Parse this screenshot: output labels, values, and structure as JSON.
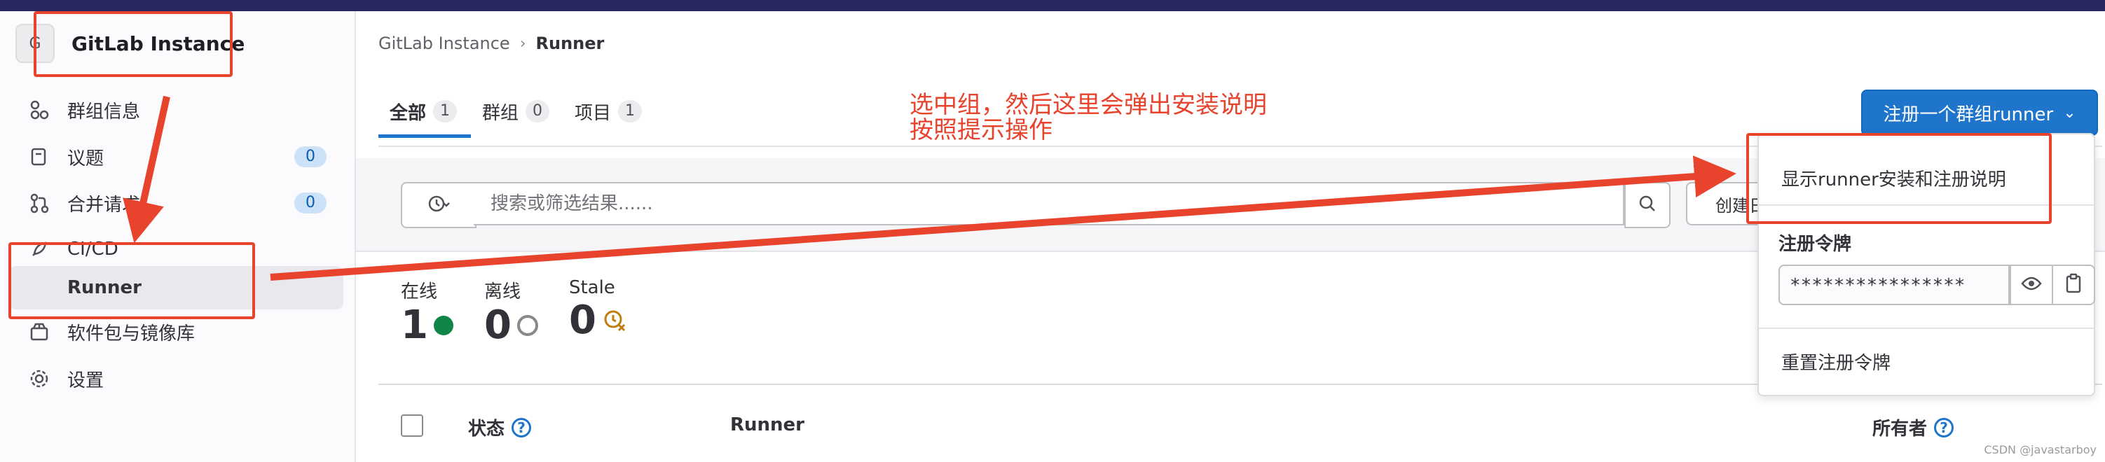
{
  "group": {
    "avatar_letter": "G",
    "name": "GitLab Instance"
  },
  "sidebar": {
    "items": [
      {
        "label": "群组信息",
        "icon": "group-info-icon"
      },
      {
        "label": "议题",
        "icon": "issues-icon",
        "count": "0"
      },
      {
        "label": "合并请求",
        "icon": "merge-request-icon",
        "count": "0"
      },
      {
        "label": "CI/CD",
        "icon": "rocket-icon"
      },
      {
        "label": "Runner",
        "active": true
      },
      {
        "label": "软件包与镜像库",
        "icon": "package-icon"
      },
      {
        "label": "设置",
        "icon": "settings-icon"
      }
    ]
  },
  "breadcrumb": {
    "root": "GitLab Instance",
    "current": "Runner"
  },
  "tabs": [
    {
      "label": "全部",
      "count": "1",
      "active": true
    },
    {
      "label": "群组",
      "count": "0"
    },
    {
      "label": "项目",
      "count": "1"
    }
  ],
  "register_button": {
    "label": "注册一个群组runner"
  },
  "search": {
    "placeholder": "搜索或筛选结果......",
    "sort_label": "创建日期"
  },
  "stats": [
    {
      "label": "在线",
      "value": "1",
      "status": "online",
      "color": "#108548"
    },
    {
      "label": "离线",
      "value": "0",
      "status": "offline",
      "color": "#89888d"
    },
    {
      "label": "Stale",
      "value": "0",
      "status": "stale",
      "color": "#c17d10"
    }
  ],
  "table": {
    "headers": {
      "status": "状态",
      "runner": "Runner",
      "owner": "所有者"
    }
  },
  "dropdown": {
    "show_instructions": "显示runner安装和注册说明",
    "token_heading": "注册令牌",
    "token_value": "****************",
    "reset_token": "重置注册令牌"
  },
  "annotation": {
    "line1": "选中组，然后这里会弹出安装说明",
    "line2": "按照提示操作"
  },
  "watermark": "CSDN @javastarboy",
  "colors": {
    "accent": "#1f75cb",
    "annotation": "#e8432d",
    "topbar": "#292961"
  }
}
